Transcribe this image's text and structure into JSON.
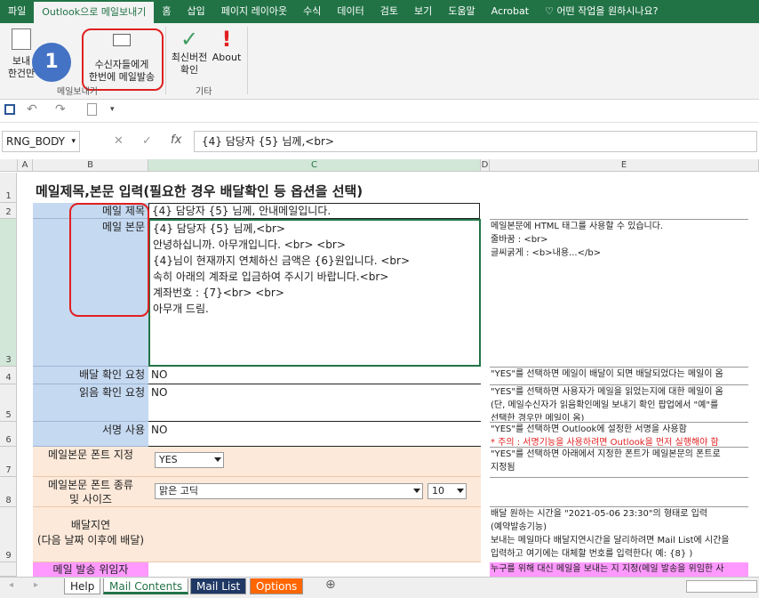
{
  "ribbon_tabs": [
    "파일",
    "Outlook으로 메일보내기",
    "홈",
    "삽입",
    "페이지 레이아웃",
    "수식",
    "데이터",
    "검토",
    "보기",
    "도움말",
    "Acrobat",
    "어떤 작업을 원하시나요?"
  ],
  "ribbon": {
    "btn1_line1": "보내",
    "btn1_line2": "한건만",
    "group1_label": "메일보내기",
    "send_line1": "수신자들에게",
    "send_line2": "한번에 메일발송",
    "latest_line1": "최신버전",
    "latest_line2": "확인",
    "about_label": "About",
    "group2_label": "기타",
    "badge": "1"
  },
  "formula_bar": {
    "name_box": "RNG_BODY",
    "fx": "fx",
    "cancel": "✕",
    "enter": "✓",
    "content": "{4} 담당자 {5} 님께,<br>"
  },
  "columns": [
    "A",
    "B",
    "C",
    "D",
    "E"
  ],
  "rows": [
    "1",
    "2",
    "3",
    "4",
    "5",
    "6",
    "7",
    "8",
    "9"
  ],
  "title": "메일제목,본문 입력(필요한 경우 배달확인 등 옵션을 선택)",
  "fields": {
    "subject_label": "메일 제목",
    "subject_value": "{4} 담당자 {5} 님께, 안내메일입니다.",
    "body_label": "메일 본문",
    "body_lines": [
      "{4} 담당자 {5} 님께,<br>",
      "안녕하십니까. 아무개입니다. <br> <br>",
      "{4}님이 현재까지 연체하신 금액은 {6}원입니다. <br>",
      "속히 아래의 계좌로 입금하여 주시기 바랍니다.<br>",
      "계좌번호 : {7}<br> <br>",
      "아무개 드림."
    ],
    "delivery_label": "배달 확인 요청",
    "delivery_value": "NO",
    "read_label": "읽음 확인 요청",
    "read_value": "NO",
    "signature_label": "서명 사용",
    "signature_value": "NO",
    "font_spec_label": "메일본문 폰트 지정",
    "font_spec_value": "YES",
    "font_type_label1": "메일본문 폰트 종류",
    "font_type_label2": "및 사이즈",
    "font_name": "맑은 고딕",
    "font_size": "10",
    "delay_label1": "배달지연",
    "delay_label2": "(다음 날짜 이후에 배달)",
    "delegate_label": "메일 발송 위임자"
  },
  "notes": {
    "body": [
      "메일본문에 HTML 태그를 사용할 수 있습니다.",
      "줄바꿈 : <br>",
      "글씨굵게 : <b>내용...</b>"
    ],
    "delivery": "\"YES\"를 선택하면 메일이 배달이 되면 배달되었다는 메일이 옴",
    "read": [
      "\"YES\"를 선택하면 사용자가 메일을 읽었는지에 대한 메일이 옴",
      "(단,  메일수신자가 읽음확인메일 보내기 확인 팝업에서 \"예\"를",
      "선택한 경우만 메일이 옴)"
    ],
    "signature": "\"YES\"를 선택하면 Outlook에 설정한 서명을 사용함",
    "signature_warn": "* 주의 : 서명기능을 사용하려면 Outlook을 먼저 실행해야 함",
    "font_spec": [
      "\"YES\"를 선택하면 아래에서 지정한 폰트가 메일본문의 폰트로",
      "지정됨"
    ],
    "delay": [
      "배달 원하는 시간을 \"2021-05-06 23:30\"의 형태로 입력",
      "(예약발송기능)",
      "보내는 메일마다 배달지연시간을 달리하려면 Mail List에 시간을",
      "입력하고 여기에는 대체할 번호를 입력한다( 예: {8} )"
    ],
    "delegate": "누구를 위해 대신 메일을 보내는 지 지정(메일 발송을 위임한 사"
  },
  "sheet_tabs": [
    "Help",
    "Mail Contents",
    "Mail List",
    "Options"
  ],
  "colors": {
    "excel_green": "#217346",
    "blue_label": "#c5d9f1",
    "orange_label": "#fde9d9",
    "pink": "#ff99ff",
    "badge": "#4472c4",
    "circle": "#e02020"
  }
}
